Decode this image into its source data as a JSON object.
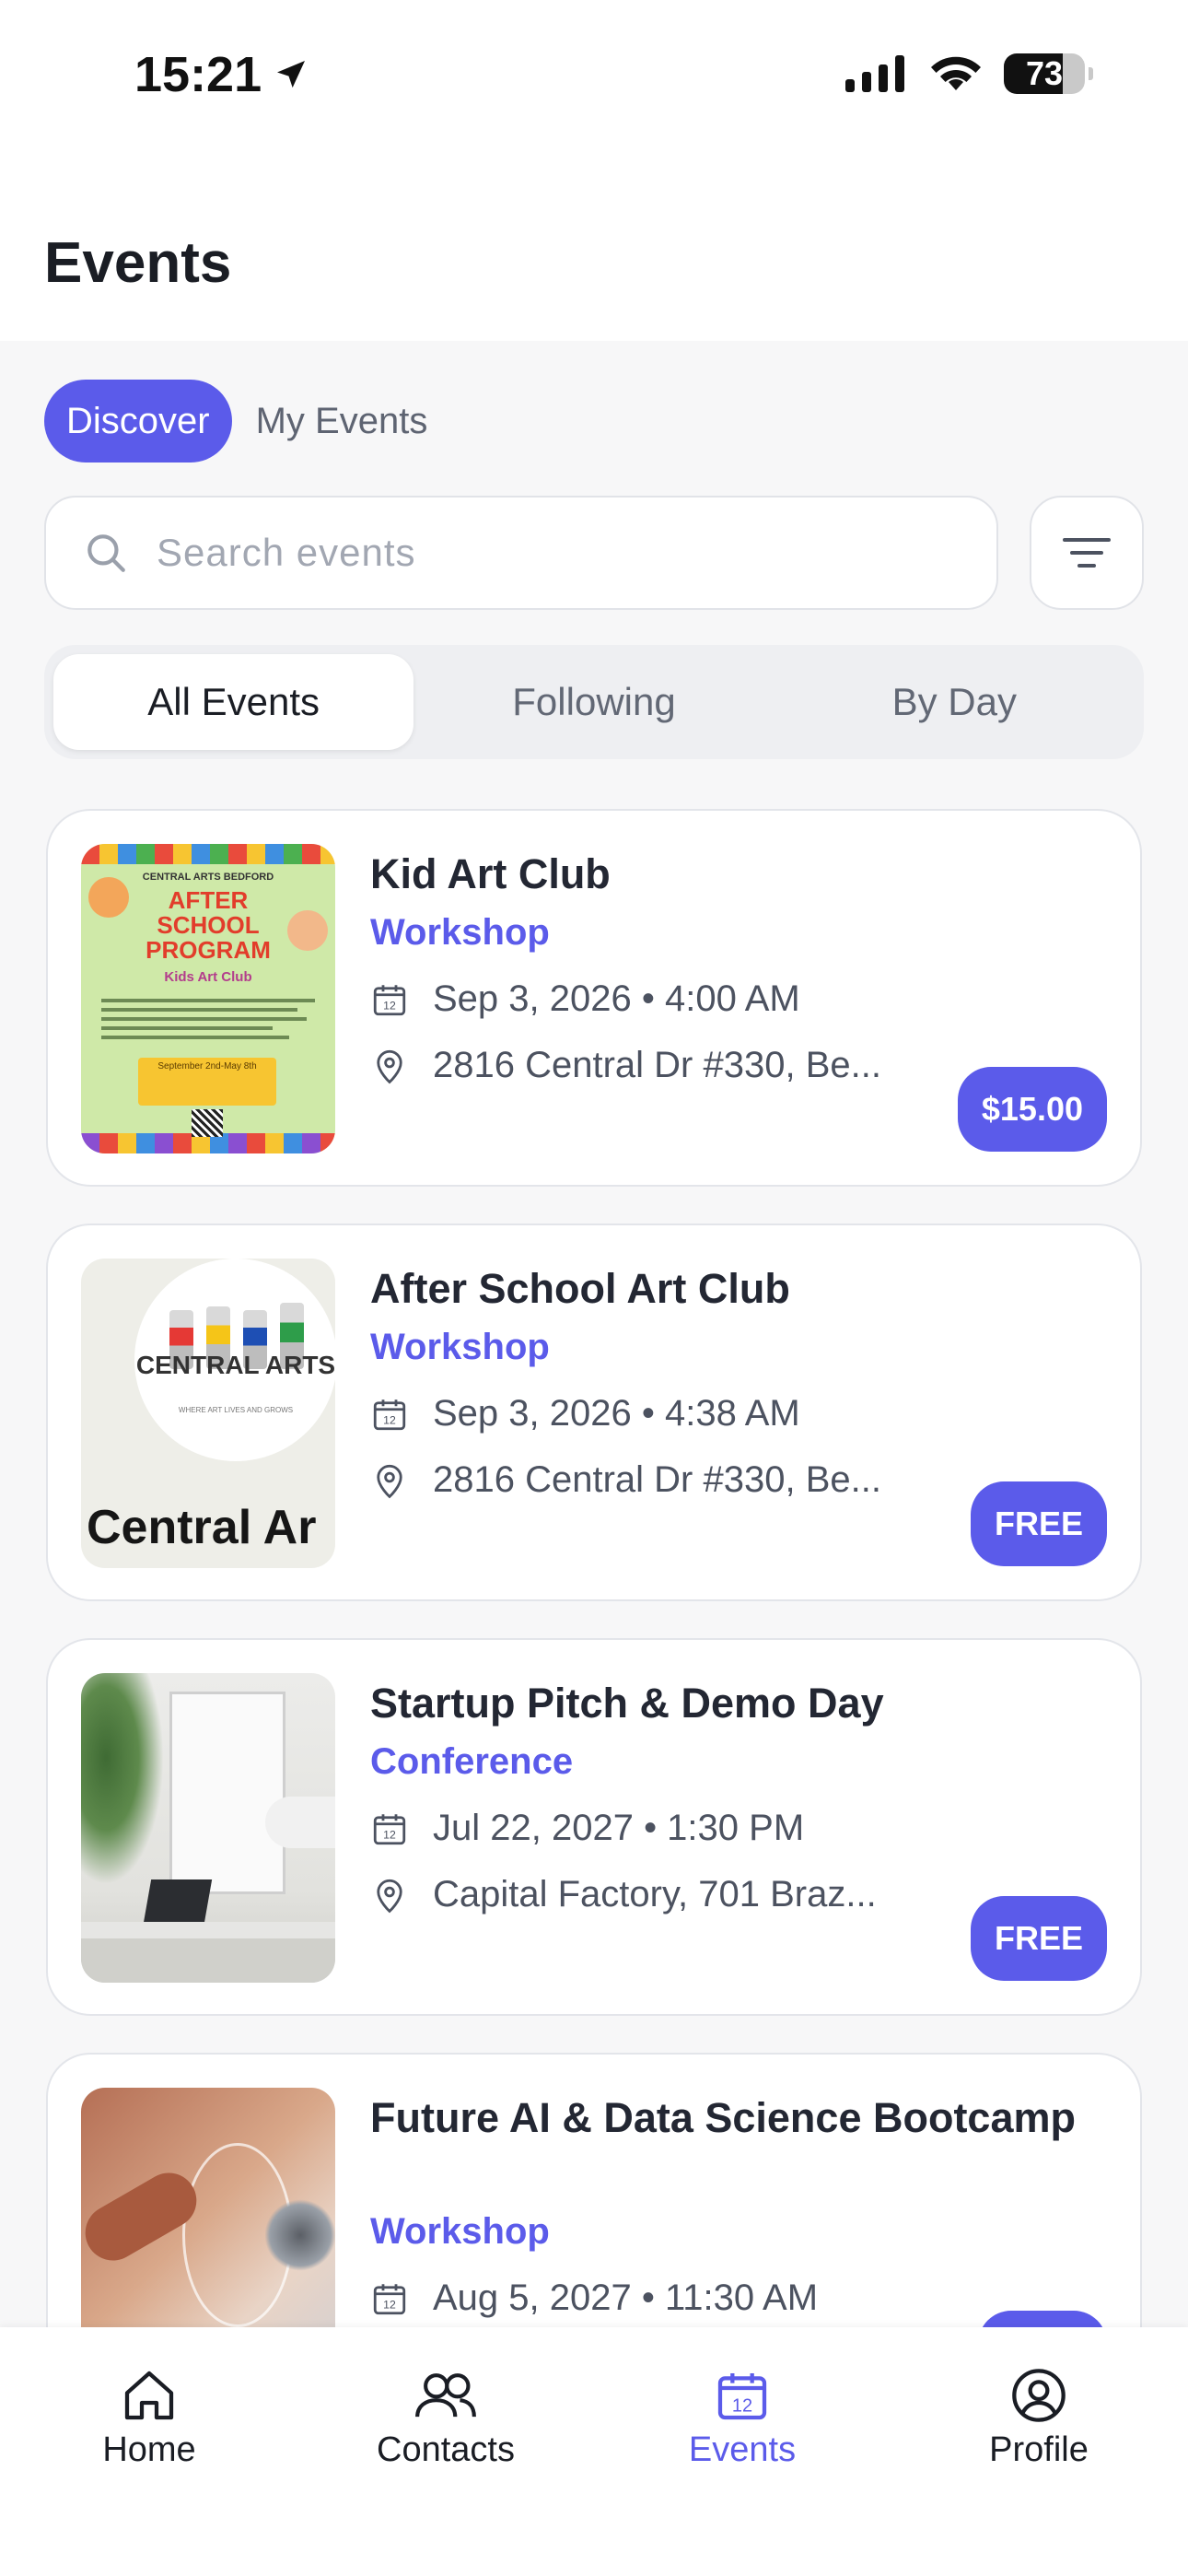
{
  "status": {
    "time": "15:21",
    "battery": "73"
  },
  "header": {
    "title": "Events"
  },
  "view_tabs": [
    "Discover",
    "My Events"
  ],
  "search": {
    "placeholder": "Search events"
  },
  "segments": [
    "All Events",
    "Following",
    "By Day"
  ],
  "events": [
    {
      "title": "Kid Art Club",
      "category": "Workshop",
      "datetime": "Sep 3, 2026 • 4:00 AM",
      "location": "2816 Central Dr #330, Be...",
      "price": "$15.00"
    },
    {
      "title": "After School Art Club",
      "category": "Workshop",
      "datetime": "Sep 3, 2026 • 4:38 AM",
      "location": "2816 Central Dr #330, Be...",
      "price": "FREE"
    },
    {
      "title": "Startup Pitch & Demo Day",
      "category": "Conference",
      "datetime": "Jul 22, 2027 • 1:30 PM",
      "location": "Capital Factory, 701 Braz...",
      "price": "FREE"
    },
    {
      "title": "Future AI & Data Science Bootcamp",
      "category": "Workshop",
      "datetime": "Aug 5, 2027 • 11:30 AM"
    }
  ],
  "poster": {
    "header": "CENTRAL ARTS BEDFORD",
    "line1": "AFTER",
    "line2": "SCHOOL",
    "line3": "PROGRAM",
    "sub": "Kids Art Club",
    "dates": "September 2nd-May 8th"
  },
  "logo": {
    "name": "CENTRAL ARTS",
    "tagline": "WHERE ART LIVES AND GROWS",
    "caption": "Central Ar"
  },
  "nav": [
    {
      "label": "Home",
      "icon": "home-icon"
    },
    {
      "label": "Contacts",
      "icon": "contacts-icon"
    },
    {
      "label": "Events",
      "icon": "calendar-icon",
      "calendar_day": "12"
    },
    {
      "label": "Profile",
      "icon": "profile-icon"
    }
  ],
  "colors": {
    "accent": "#5b5bea",
    "text": "#1f2430",
    "muted": "#5e6472"
  }
}
